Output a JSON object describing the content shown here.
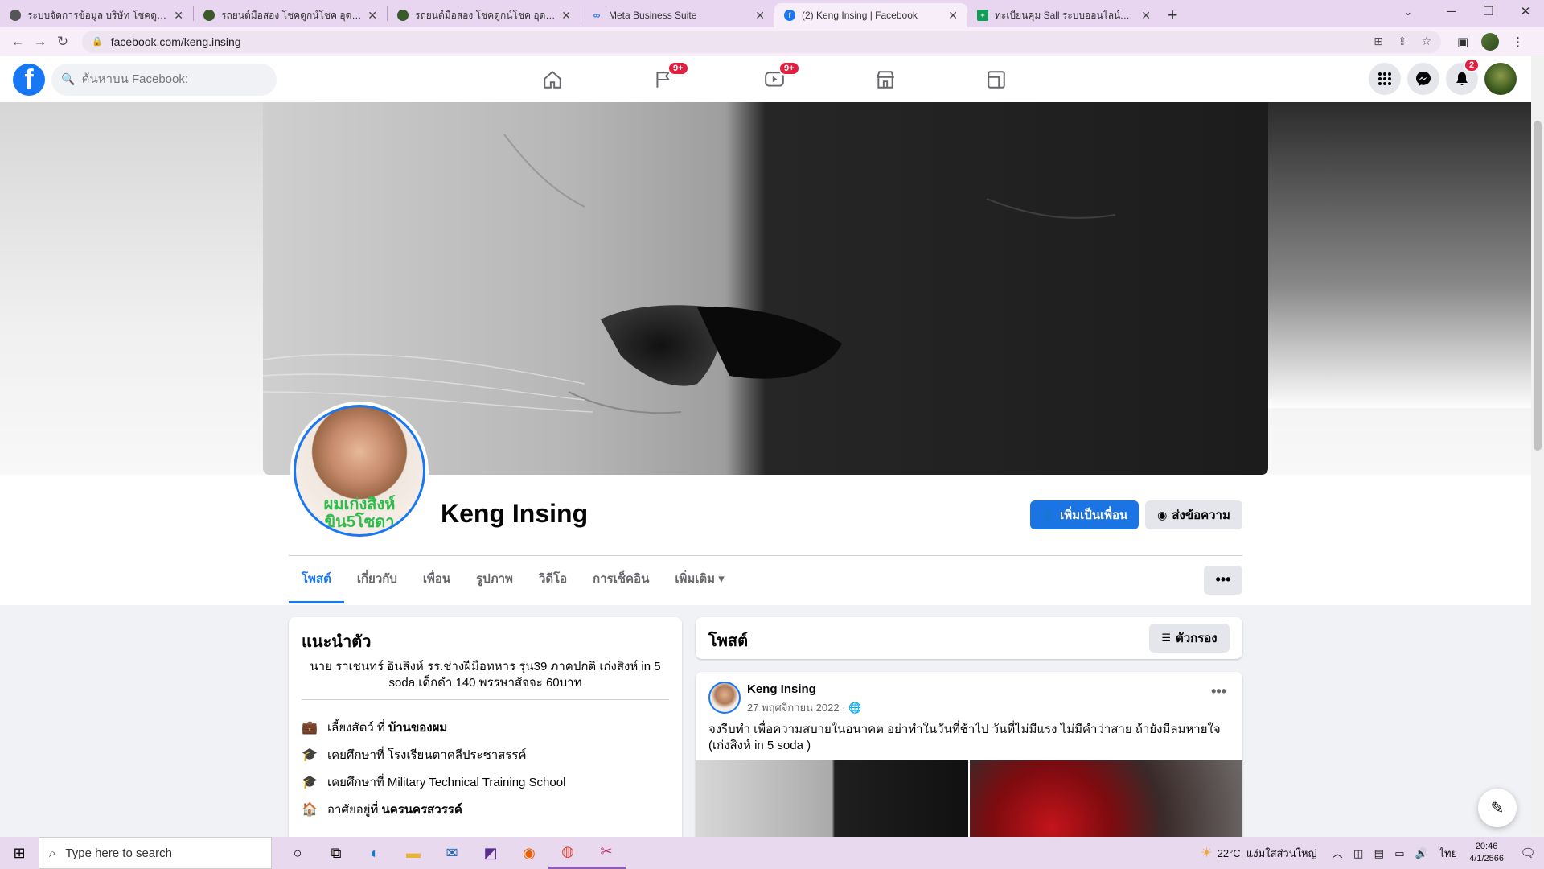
{
  "browser": {
    "tabs": [
      {
        "title": "ระบบจัดการข้อมูล บริษัท โชคดูกน์โชค",
        "favicon_color": "#555555"
      },
      {
        "title": "รถยนต์มือสอง โชคดูกน์โชค อุดรธานี",
        "favicon_color": "#3a5a2a"
      },
      {
        "title": "รถยนต์มือสอง โชคดูกน์โชค อุดรธานี",
        "favicon_color": "#3a5a2a"
      },
      {
        "title": "Meta Business Suite",
        "favicon_color": "#1877f2"
      },
      {
        "title": "(2) Keng Insing | Facebook",
        "favicon_color": "#1877f2",
        "active": true
      },
      {
        "title": "ทะเบียนคุม Sall ระบบออนไลน์.xlsx - G",
        "favicon_color": "#0f9d58"
      }
    ],
    "url": "facebook.com/keng.insing"
  },
  "fb_header": {
    "search_placeholder": "ค้นหาบน Facebook:",
    "pages_badge": "9+",
    "watch_badge": "9+",
    "notifications_badge": "2"
  },
  "profile": {
    "name": "Keng Insing",
    "picture_text": "ผมเก่งสิงห์ ขิน5โซดา",
    "add_friend_label": "เพิ่มเป็นเพื่อน",
    "message_label": "ส่งข้อความ",
    "tabs": [
      "โพสต์",
      "เกี่ยวกับ",
      "เพื่อน",
      "รูปภาพ",
      "วิดีโอ",
      "การเช็คอิน",
      "เพิ่มเติม"
    ],
    "more_dots": "•••"
  },
  "intro": {
    "title": "แนะนำตัว",
    "bio": "นาย ราเชนทร์ อินสิงห์ รร.ช่างฝีมือทหาร รุ่น39 ภาคปกติ เก่งสิงห์ in 5 soda เด็กดำ 140 พรรษาสัจจะ 60บาท",
    "rows": [
      {
        "prefix": "เลี้ยงสัตว์ ที่",
        "bold": "บ้านของผม"
      },
      {
        "prefix": "เคยศึกษาที่ โรงเรียนตาคลีประชาสรรค์",
        "bold": ""
      },
      {
        "prefix": "เคยศึกษาที่ Military Technical Training School",
        "bold": ""
      },
      {
        "prefix": "อาศัยอยู่ที่",
        "bold": "นครนครสวรรค์"
      }
    ]
  },
  "posts": {
    "title": "โพสต์",
    "filter_label": "ตัวกรอง",
    "post": {
      "author": "Keng Insing",
      "date": "27 พฤศจิกายน 2022",
      "text": "จงรีบทำ เพื่อความสบายในอนาคต อย่าทำในวันที่ช้าไป วันที่ไม่มีแรง ไม่มีคำว่าสาย ถ้ายังมีลมหายใจ (เก่งสิงห์ in 5 soda )"
    }
  },
  "taskbar": {
    "search_placeholder": "Type here to search",
    "weather_temp": "22°C",
    "weather_text": "แง่มใสส่วนใหญ่",
    "lang": "ไทย",
    "time": "20:46",
    "date": "4/1/2566"
  }
}
